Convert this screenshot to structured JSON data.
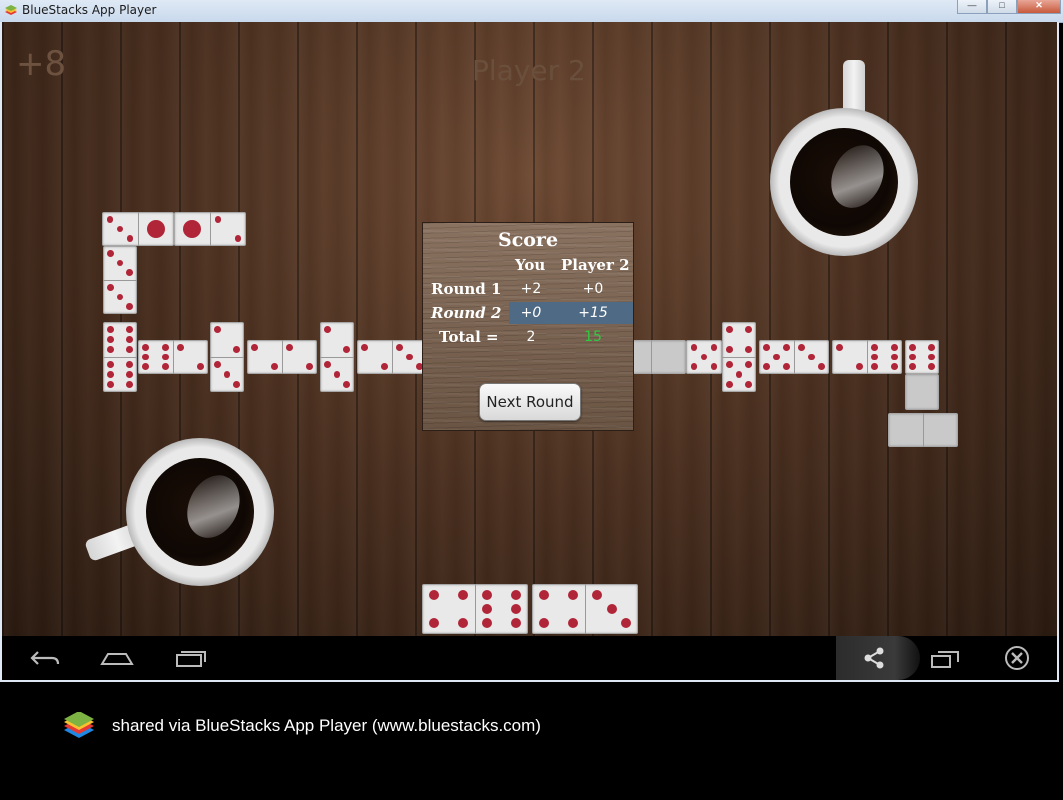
{
  "window": {
    "title": "BlueStacks App Player",
    "minimize_label": "—",
    "maximize_label": "□",
    "close_label": "✕"
  },
  "game": {
    "corner_score": "+8",
    "player_label": "Player 2"
  },
  "score_dialog": {
    "title": "Score",
    "col_you": "You",
    "col_player2": "Player 2",
    "rows": [
      {
        "label": "Round 1",
        "you": "+2",
        "player2": "+0"
      },
      {
        "label": "Round 2",
        "you": "+0",
        "player2": "+15"
      },
      {
        "label": "Total =",
        "you": "2",
        "player2": "15"
      }
    ],
    "next_button": "Next Round"
  },
  "colors": {
    "pip": "#b02638",
    "highlight": "#4e6a85",
    "total_player2": "#2ecc40"
  },
  "navbar": {
    "icons": [
      "back-icon",
      "home-icon",
      "recent-apps-icon",
      "share-icon",
      "window-toggle-icon",
      "close-app-icon"
    ]
  },
  "footer": {
    "text": "shared via BlueStacks App Player (www.bluestacks.com)"
  }
}
